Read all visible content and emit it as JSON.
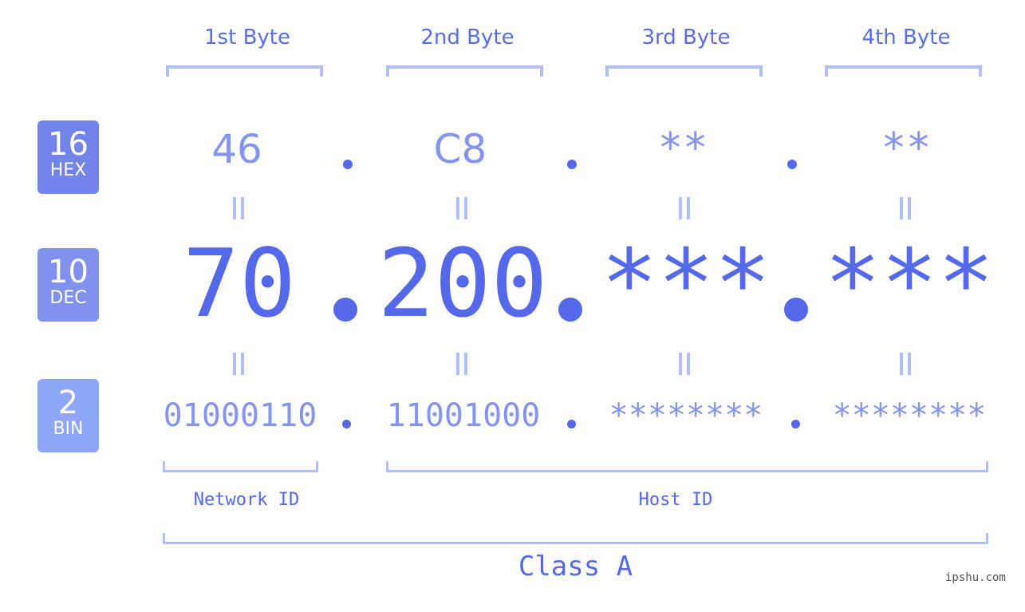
{
  "byte_headers": [
    "1st Byte",
    "2nd Byte",
    "3rd Byte",
    "4th Byte"
  ],
  "badges": {
    "hex": {
      "number": "16",
      "label": "HEX",
      "color": "#7283ea"
    },
    "dec": {
      "number": "10",
      "label": "DEC",
      "color": "#8192ee"
    },
    "bin": {
      "number": "2",
      "label": "BIN",
      "color": "#8ea6f8"
    }
  },
  "hex": [
    "46",
    "C8",
    "**",
    "**"
  ],
  "dec": [
    "70",
    "200",
    "***",
    "***"
  ],
  "bin": [
    "01000110",
    "11001000",
    "********",
    "********"
  ],
  "network_id_label": "Network ID",
  "host_id_label": "Host ID",
  "class_label": "Class A",
  "watermark": "ipshu.com",
  "colors": {
    "accent": "#5468e9",
    "light": "#8594ee",
    "bracket": "#b3bdf6"
  }
}
